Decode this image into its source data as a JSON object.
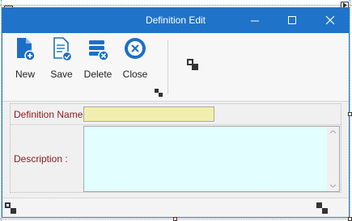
{
  "window": {
    "title": "Definition Edit"
  },
  "toolbar": {
    "new_label": "New",
    "save_label": "Save",
    "delete_label": "Delete",
    "close_label": "Close"
  },
  "form": {
    "name_label": "Definition Name :",
    "name_value": "",
    "description_label": "Description :",
    "description_value": ""
  },
  "colors": {
    "titlebar": "#1f73c8",
    "icon_blue": "#1d6fc6",
    "label_red": "#8b1a1a",
    "name_field_bg": "#f2eeaf",
    "description_field_bg": "#e2fefe"
  },
  "icons": {
    "new": "document-plus-icon",
    "save": "document-check-icon",
    "delete": "database-delete-icon",
    "close": "circle-x-icon",
    "layout": "layout-add-icon",
    "minimize": "minimize-icon",
    "maximize": "maximize-icon",
    "close_window": "close-icon"
  }
}
